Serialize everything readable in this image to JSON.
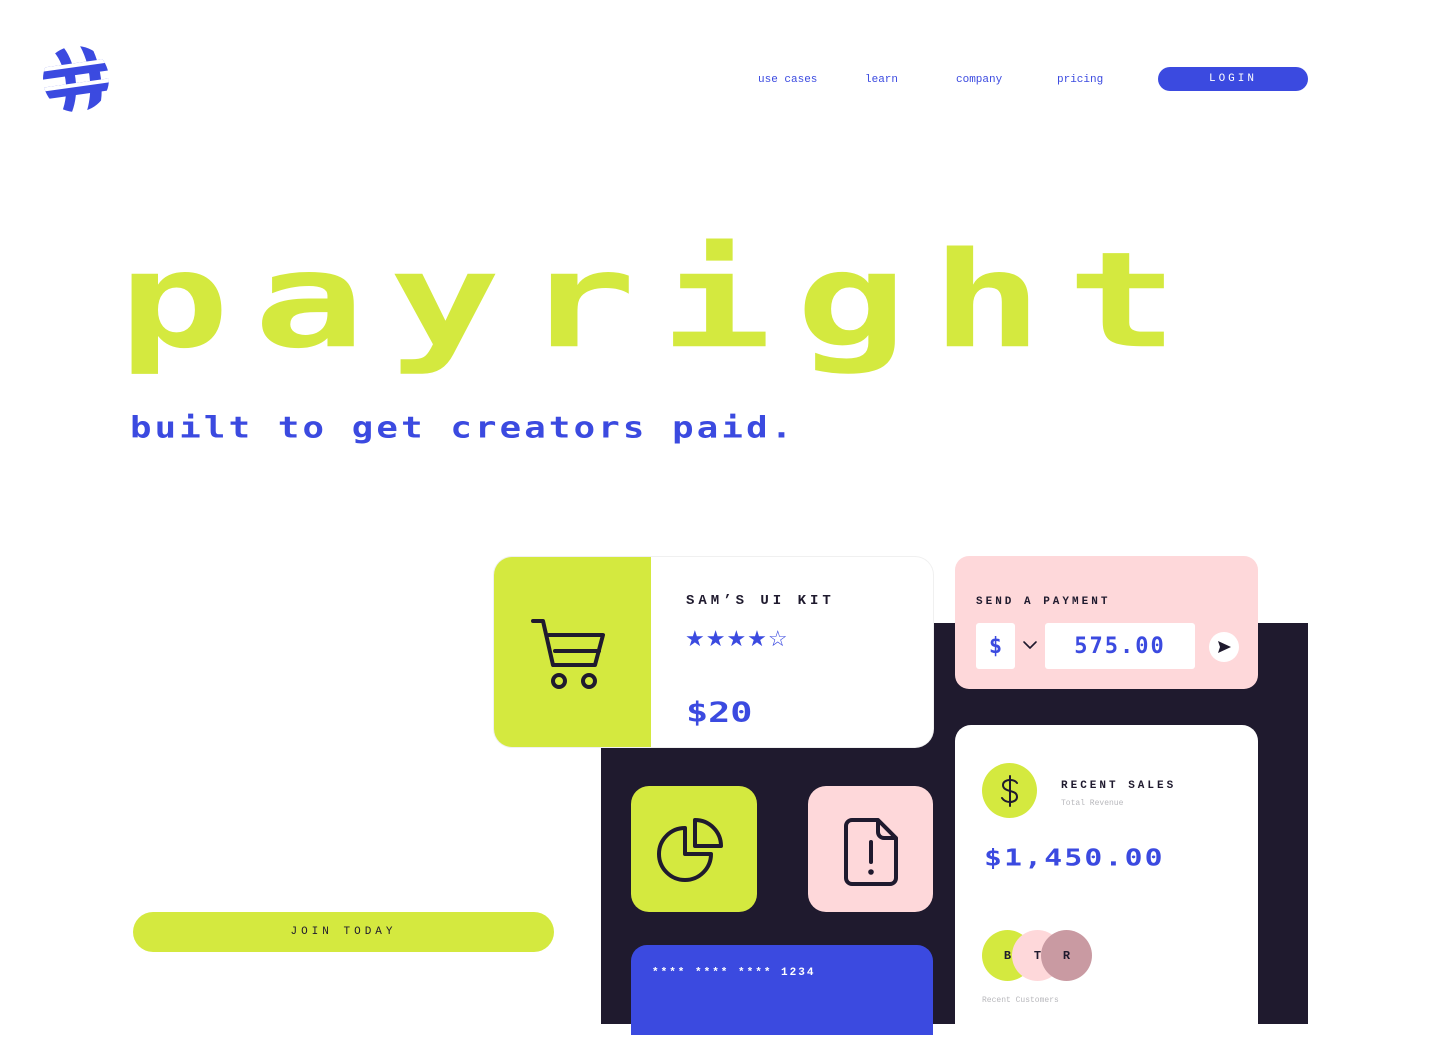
{
  "brand": {
    "logo_icon": "globe-logo-icon"
  },
  "nav": {
    "links": [
      "use cases",
      "learn",
      "company",
      "pricing"
    ],
    "login_label": "LOGIN"
  },
  "hero": {
    "title": "payright",
    "subtitle": "built to get creators paid."
  },
  "cta": {
    "join_label": "JOIN TODAY"
  },
  "product_card": {
    "name": "SAM’S UI KIT",
    "rating": 4,
    "rating_max": 5,
    "stars_text": "★★★★☆",
    "price": "$20",
    "icon": "shopping-cart-icon"
  },
  "payment": {
    "label": "SEND A PAYMENT",
    "currency": "$",
    "amount": "575.00",
    "send_icon": "send-arrow-icon"
  },
  "tiles": {
    "chart_icon": "pie-chart-icon",
    "doc_icon": "document-alert-icon"
  },
  "credit_card": {
    "number": "**** **** **** 1234"
  },
  "sales": {
    "title": "RECENT SALES",
    "subtitle": "Total Revenue",
    "amount": "$1,450.00",
    "customers": [
      "B",
      "T",
      "R"
    ],
    "customers_label": "Recent Customers"
  },
  "colors": {
    "lime": "#d4e93f",
    "blue": "#3b4ae0",
    "pink": "#fed8da",
    "dark": "#1f1a2e",
    "mauve": "#c99aa2"
  }
}
